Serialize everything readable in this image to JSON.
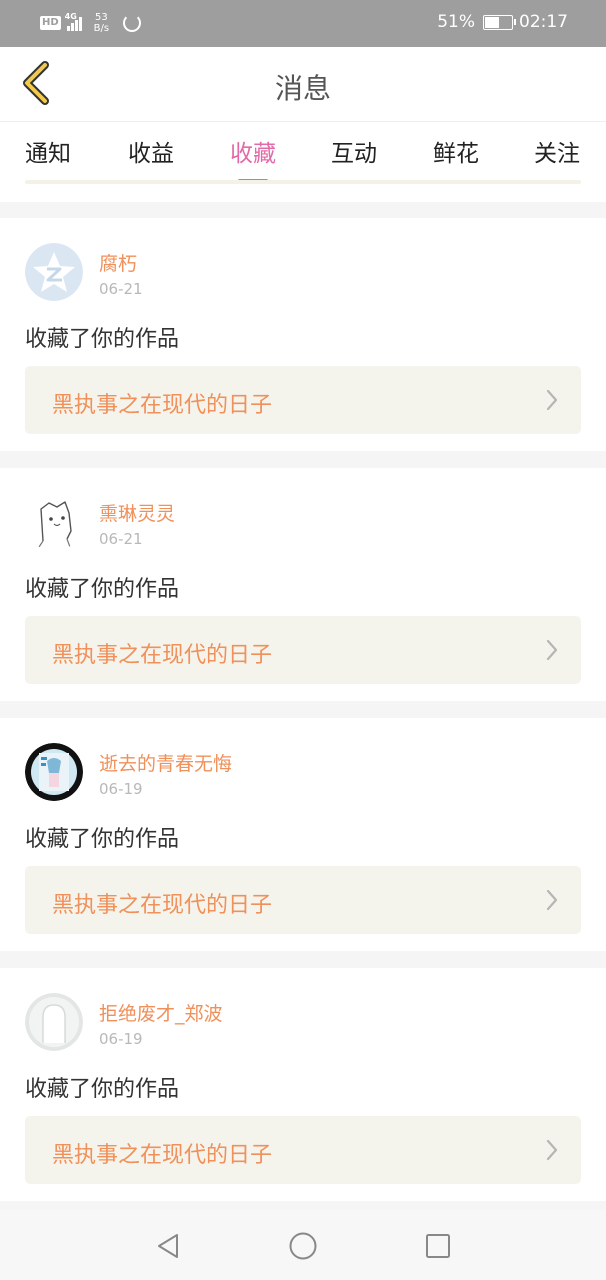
{
  "status_bar": {
    "hd": "HD",
    "network": "4G",
    "speed_value": "53",
    "speed_unit": "B/s",
    "battery_percent": "51%",
    "time": "02:17"
  },
  "header": {
    "title": "消息",
    "back_icon": "chevron-left-icon"
  },
  "tabs": [
    {
      "label": "通知",
      "active": false
    },
    {
      "label": "收益",
      "active": false
    },
    {
      "label": "收藏",
      "active": true
    },
    {
      "label": "互动",
      "active": false
    },
    {
      "label": "鲜花",
      "active": false
    },
    {
      "label": "关注",
      "active": false
    }
  ],
  "messages": [
    {
      "username": "腐朽",
      "date": "06-21",
      "text": "收藏了你的作品",
      "work_title": "黑执事之在现代的日子"
    },
    {
      "username": "熏琳灵灵",
      "date": "06-21",
      "text": "收藏了你的作品",
      "work_title": "黑执事之在现代的日子"
    },
    {
      "username": "逝去的青春无悔",
      "date": "06-19",
      "text": "收藏了你的作品",
      "work_title": "黑执事之在现代的日子"
    },
    {
      "username": "拒绝废才_郑波",
      "date": "06-19",
      "text": "收藏了你的作品",
      "work_title": "黑执事之在现代的日子"
    }
  ],
  "navbar": {
    "back_icon": "triangle-back-icon",
    "home_icon": "circle-home-icon",
    "recents_icon": "square-recents-icon"
  },
  "colors": {
    "accent": "#e26aa8",
    "username": "#f0905a",
    "work_box_bg": "#f5f4ec",
    "status_bar_bg": "#9e9e9e"
  }
}
